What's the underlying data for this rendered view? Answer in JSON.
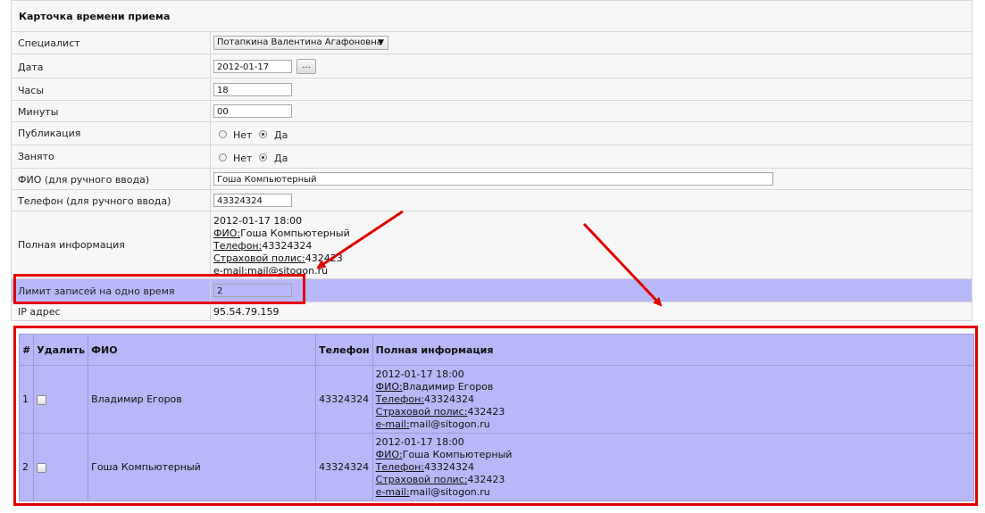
{
  "card": {
    "title": "Карточка времени приема",
    "specialist": {
      "label": "Специалист",
      "value": "Потапкина Валентина Агафоновна"
    },
    "date": {
      "label": "Дата",
      "value": "2012-01-17",
      "button": "..."
    },
    "hours": {
      "label": "Часы",
      "value": "18"
    },
    "minutes": {
      "label": "Минуты",
      "value": "00"
    },
    "publication": {
      "label": "Публикация",
      "options": [
        "Нет",
        "Да"
      ],
      "selected": "Да"
    },
    "busy": {
      "label": "Занято",
      "options": [
        "Нет",
        "Да"
      ],
      "selected": "Да"
    },
    "fio": {
      "label": "ФИО (для ручного ввода)",
      "value": "Гоша Компьютерный"
    },
    "phone": {
      "label": "Телефон (для ручного ввода)",
      "value": "43324324"
    },
    "full_info": {
      "label": "Полная информация",
      "datetime": "2012-01-17 18:00",
      "fio_key": "ФИО:",
      "fio_val": "Гоша Компьютерный",
      "phone_key": "Телефон:",
      "phone_val": "43324324",
      "policy_key": "Страховой полис:",
      "policy_val": "432423",
      "email_key": "e-mail:",
      "email_val": "mail@sitogon.ru"
    },
    "limit": {
      "label": "Лимит записей на одно время",
      "value": "2"
    },
    "ip": {
      "label": "IP адрес",
      "value": "95.54.79.159"
    }
  },
  "table": {
    "headers": {
      "num": "#",
      "delete": "Удалить",
      "fio": "ФИО",
      "phone": "Телефон",
      "info": "Полная информация"
    },
    "rows": [
      {
        "num": "1",
        "fio": "Владимир Егоров",
        "phone": "43324324",
        "datetime": "2012-01-17 18:00",
        "fio_key": "ФИО:",
        "fio_val": "Владимир Егоров",
        "phone_key": "Телефон:",
        "phone_val": "43324324",
        "policy_key": "Страховой полис:",
        "policy_val": "432423",
        "email_key": "e-mail:",
        "email_val": "mail@sitogon.ru"
      },
      {
        "num": "2",
        "fio": "Гоша Компьютерный",
        "phone": "43324324",
        "datetime": "2012-01-17 18:00",
        "fio_key": "ФИО:",
        "fio_val": "Гоша Компьютерный",
        "phone_key": "Телефон:",
        "phone_val": "43324324",
        "policy_key": "Страховой полис:",
        "policy_val": "432423",
        "email_key": "e-mail:",
        "email_val": "mail@sitogon.ru"
      }
    ]
  },
  "colors": {
    "highlight": "#b8b8f8",
    "annotation_red": "#e00000"
  }
}
